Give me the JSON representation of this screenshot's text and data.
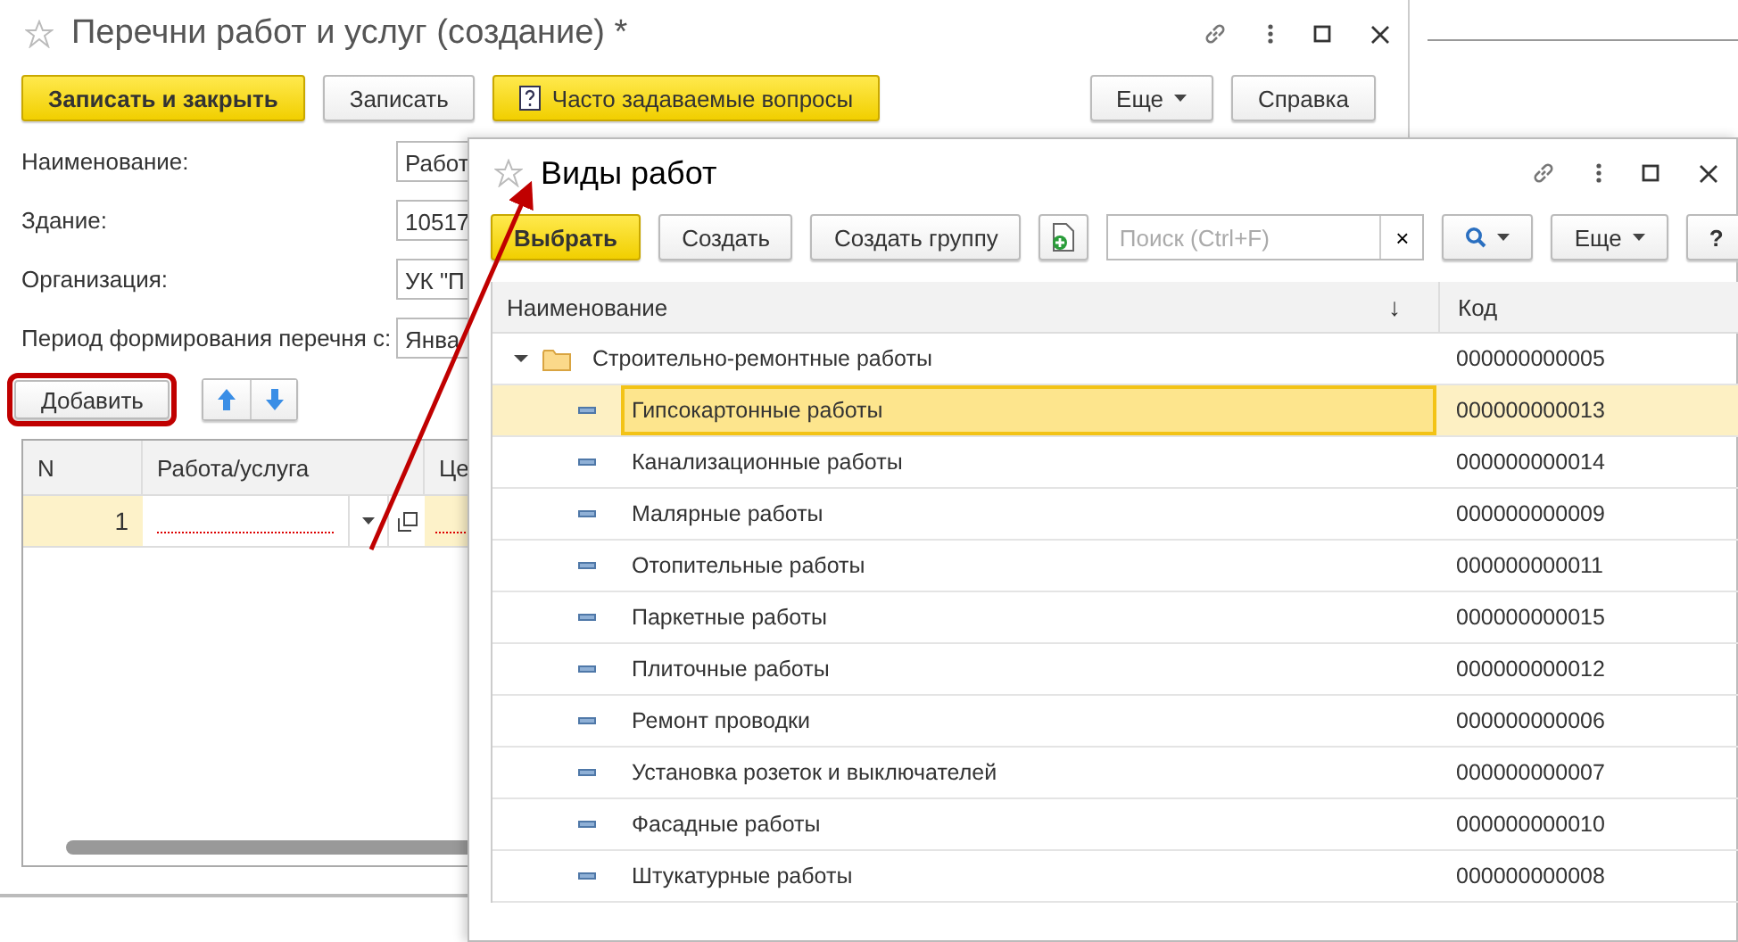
{
  "main_window": {
    "title": "Перечни работ и услуг (создание) *",
    "toolbar": [
      {
        "label": "Записать и закрыть",
        "kind": "primary"
      },
      {
        "label": "Записать",
        "kind": "normal"
      },
      {
        "label": "Часто задаваемые вопросы",
        "kind": "help"
      }
    ],
    "more_button": "Еще",
    "help_button": "Справка",
    "fields": [
      {
        "label": "Наименование:",
        "value": "Работ"
      },
      {
        "label": "Здание:",
        "value": "10517"
      },
      {
        "label": "Организация:",
        "value": "УК \"П"
      },
      {
        "label": "Период формирования перечня с:",
        "value": "Янва"
      }
    ],
    "add_button": {
      "label": "Добавить",
      "highlighted": true
    },
    "table": {
      "columns": [
        "N",
        "Работа/услуга",
        "Це"
      ],
      "rows": [
        {
          "n": "1"
        }
      ]
    }
  },
  "picker_window": {
    "title": "Виды работ",
    "toolbar": [
      "Выбрать",
      "Создать",
      "Создать группу"
    ],
    "search": {
      "placeholder": "Поиск (Ctrl+F)"
    },
    "clear_button": "×",
    "more_button": "Еще",
    "help_button": "?",
    "columns": [
      "Наименование",
      "Код"
    ],
    "sort_indicator": "↓",
    "tree": [
      {
        "name": "Строительно-ремонтные работы",
        "code": "000000000005",
        "expanded": true,
        "children": [
          {
            "name": "Гипсокартонные работы",
            "code": "000000000013",
            "selected": true
          },
          {
            "name": "Канализационные работы",
            "code": "000000000014",
            "selected": false
          },
          {
            "name": "Малярные работы",
            "code": "000000000009",
            "selected": false
          },
          {
            "name": "Отопительные работы",
            "code": "000000000011",
            "selected": false
          },
          {
            "name": "Паркетные работы",
            "code": "000000000015",
            "selected": false
          },
          {
            "name": "Плиточные работы",
            "code": "000000000012",
            "selected": false
          },
          {
            "name": "Ремонт проводки",
            "code": "000000000006",
            "selected": false
          },
          {
            "name": "Установка розеток и выключателей",
            "code": "000000000007",
            "selected": false
          },
          {
            "name": "Фасадные работы",
            "code": "000000000010",
            "selected": false
          },
          {
            "name": "Штукатурные работы",
            "code": "000000000008",
            "selected": false
          }
        ]
      }
    ]
  }
}
